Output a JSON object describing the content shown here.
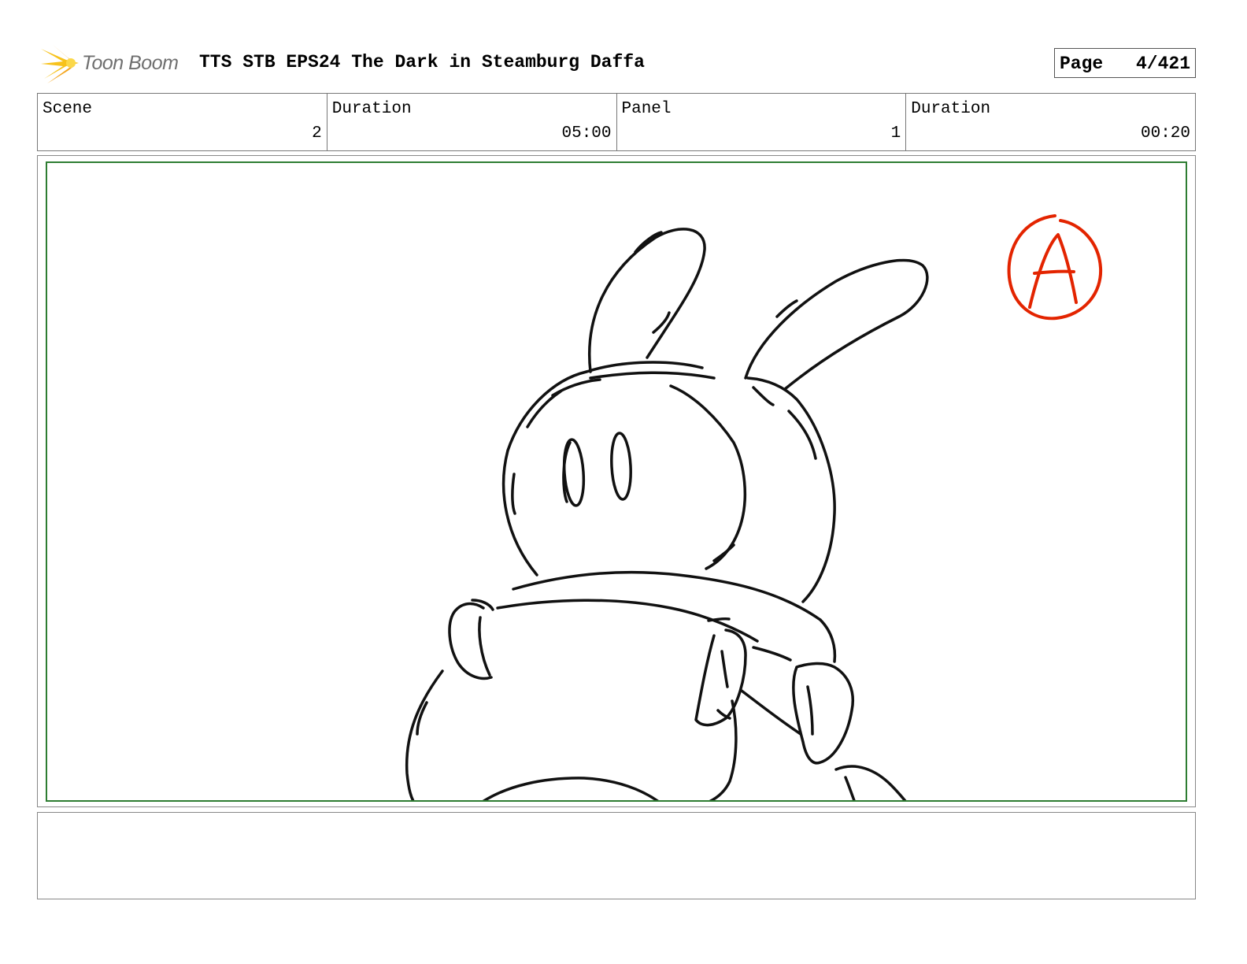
{
  "header": {
    "logo_text": "Toon Boom",
    "logo_icon": "starburst-icon",
    "title": "TTS STB EPS24 The Dark in Steamburg Daffa",
    "page_label": "Page",
    "page_number": "4/421"
  },
  "info": {
    "scene_label": "Scene",
    "scene_value": "2",
    "scene_duration_label": "Duration",
    "scene_duration_value": "05:00",
    "panel_label": "Panel",
    "panel_value": "1",
    "panel_duration_label": "Duration",
    "panel_duration_value": "00:20"
  },
  "panel": {
    "drawing": "bunny-character-sketch",
    "annotation_icon": "circled-letter-a",
    "annotation_color": "#e32400",
    "safe_area_color": "#2e7d32"
  },
  "notes": {
    "text": ""
  }
}
